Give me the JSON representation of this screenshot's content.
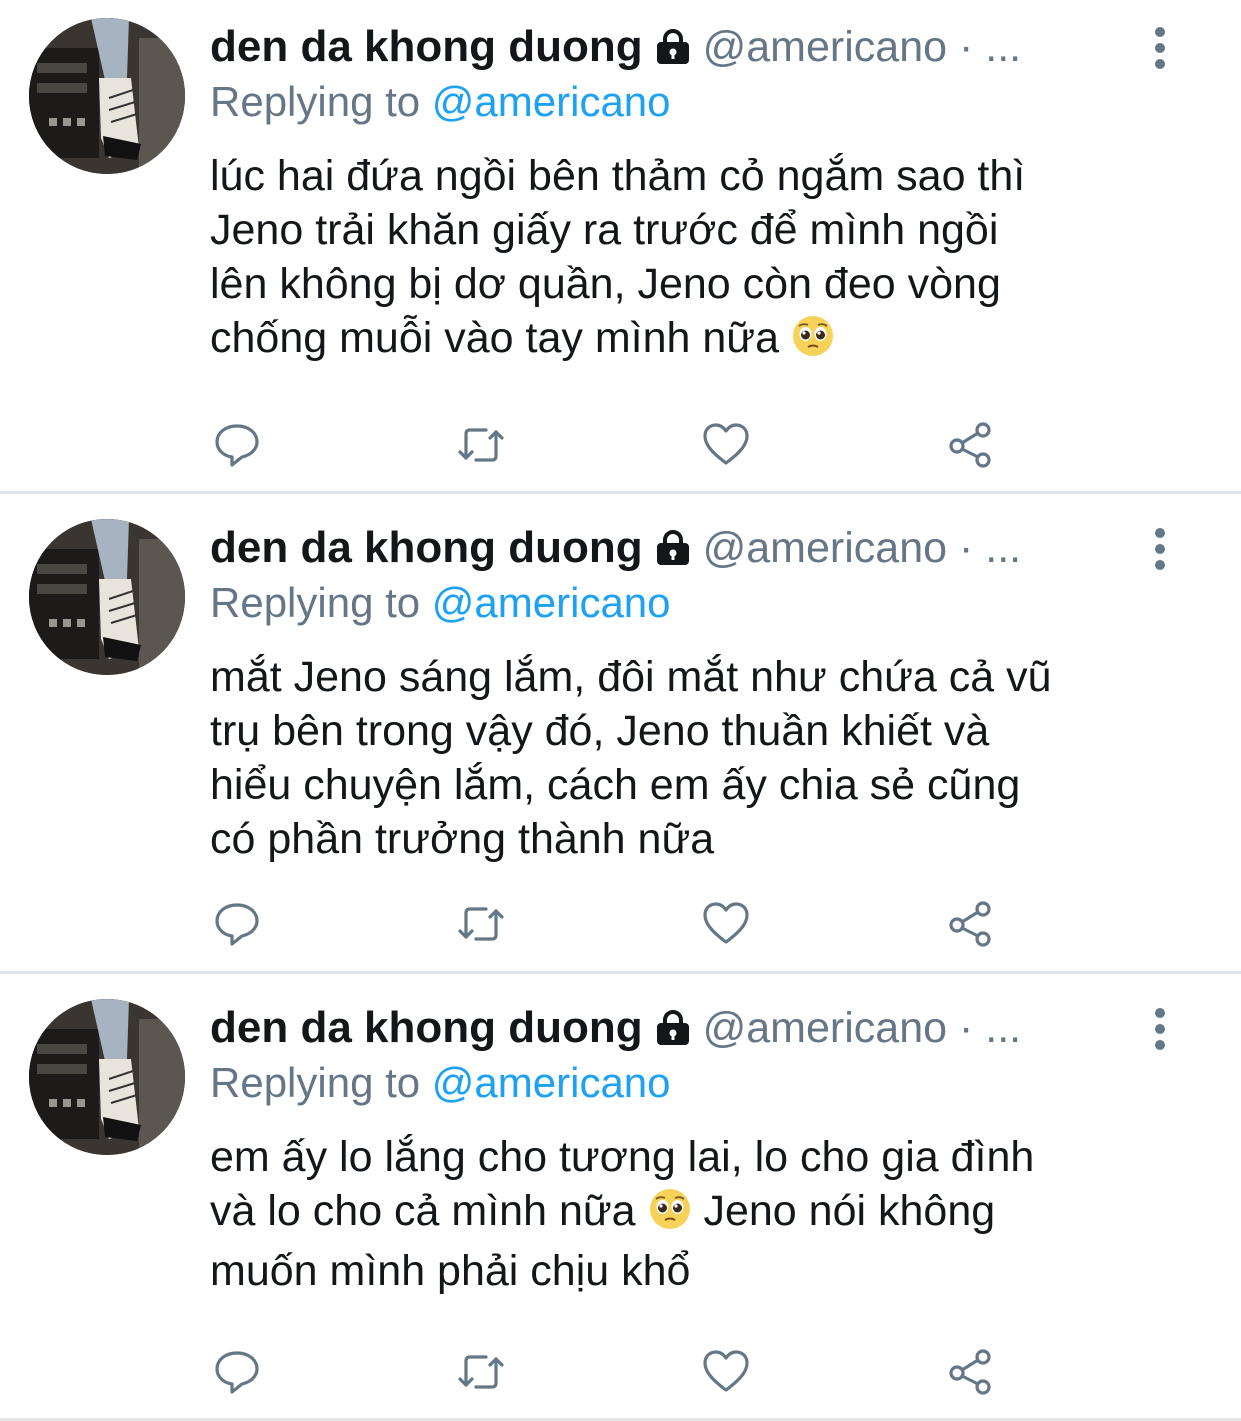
{
  "tweets": [
    {
      "author": {
        "name": "den da khong duong",
        "handle": "@americano",
        "meta": " · ..."
      },
      "replying_label": "Replying to ",
      "replying_to": "@americano",
      "text_before_emoji": "lúc hai đứa ngồi bên thảm cỏ ngắm sao thì\nJeno trải khăn giấy ra trước để mình ngồi\nlên không bị dơ quần, Jeno còn đeo vòng\nchống muỗi vào tay mình nữa ",
      "emoji": "pleading-face-emoji",
      "text_after_emoji": ""
    },
    {
      "author": {
        "name": "den da khong duong",
        "handle": "@americano",
        "meta": " · ..."
      },
      "replying_label": "Replying to ",
      "replying_to": "@americano",
      "text_before_emoji": "mắt Jeno sáng lắm, đôi mắt như chứa cả vũ\ntrụ bên trong vậy đó, Jeno thuần khiết và\nhiểu chuyện lắm, cách em ấy chia sẻ cũng\ncó phần trưởng thành nữa",
      "emoji": "",
      "text_after_emoji": ""
    },
    {
      "author": {
        "name": "den da khong duong",
        "handle": "@americano",
        "meta": " · ..."
      },
      "replying_label": "Replying to ",
      "replying_to": "@americano",
      "text_before_emoji": "em ấy lo lắng cho tương lai, lo cho gia đình\nvà lo cho cả mình nữa ",
      "emoji": "pleading-face-emoji",
      "text_after_emoji": "  Jeno nói không\nmuốn mình phải chịu khổ"
    }
  ],
  "icons": {
    "reply": "reply-icon",
    "retweet": "retweet-icon",
    "like": "heart-icon",
    "share": "share-icon",
    "more": "more-vertical-icon",
    "lock": "lock-icon"
  },
  "colors": {
    "name": "#14171a",
    "secondary": "#657786",
    "mention": "#1da1f2",
    "divider": "#e3e6e8",
    "action_icon": "#657786"
  }
}
